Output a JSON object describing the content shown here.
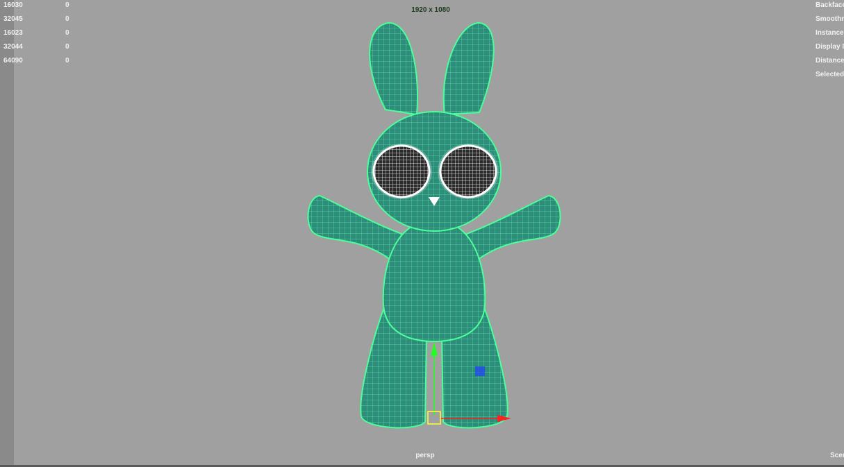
{
  "heads_up_display": {
    "stats_left": [
      {
        "value": "16030",
        "selected": "0"
      },
      {
        "value": "32045",
        "selected": "0"
      },
      {
        "value": "16023",
        "selected": "0"
      },
      {
        "value": "32044",
        "selected": "0"
      },
      {
        "value": "64090",
        "selected": "0"
      }
    ],
    "stats_right": [
      "Backface",
      "Smoothn",
      "Instance",
      "Display I",
      "Distance",
      "Selected"
    ],
    "resolution_gate": "1920 x 1080",
    "camera_name": "persp",
    "scene_label": "Scen"
  },
  "viewport": {
    "background_color": "#a0a0a0",
    "wireframe_color": "#4dff9a",
    "surface_color": "#2e8c7a",
    "eye_color": "#ffffff",
    "manipulator_y_color": "#22ff22",
    "manipulator_x_color": "#ff2020",
    "manipulator_z_color": "#2040ff",
    "manipulator_center_color": "#ffff33"
  }
}
